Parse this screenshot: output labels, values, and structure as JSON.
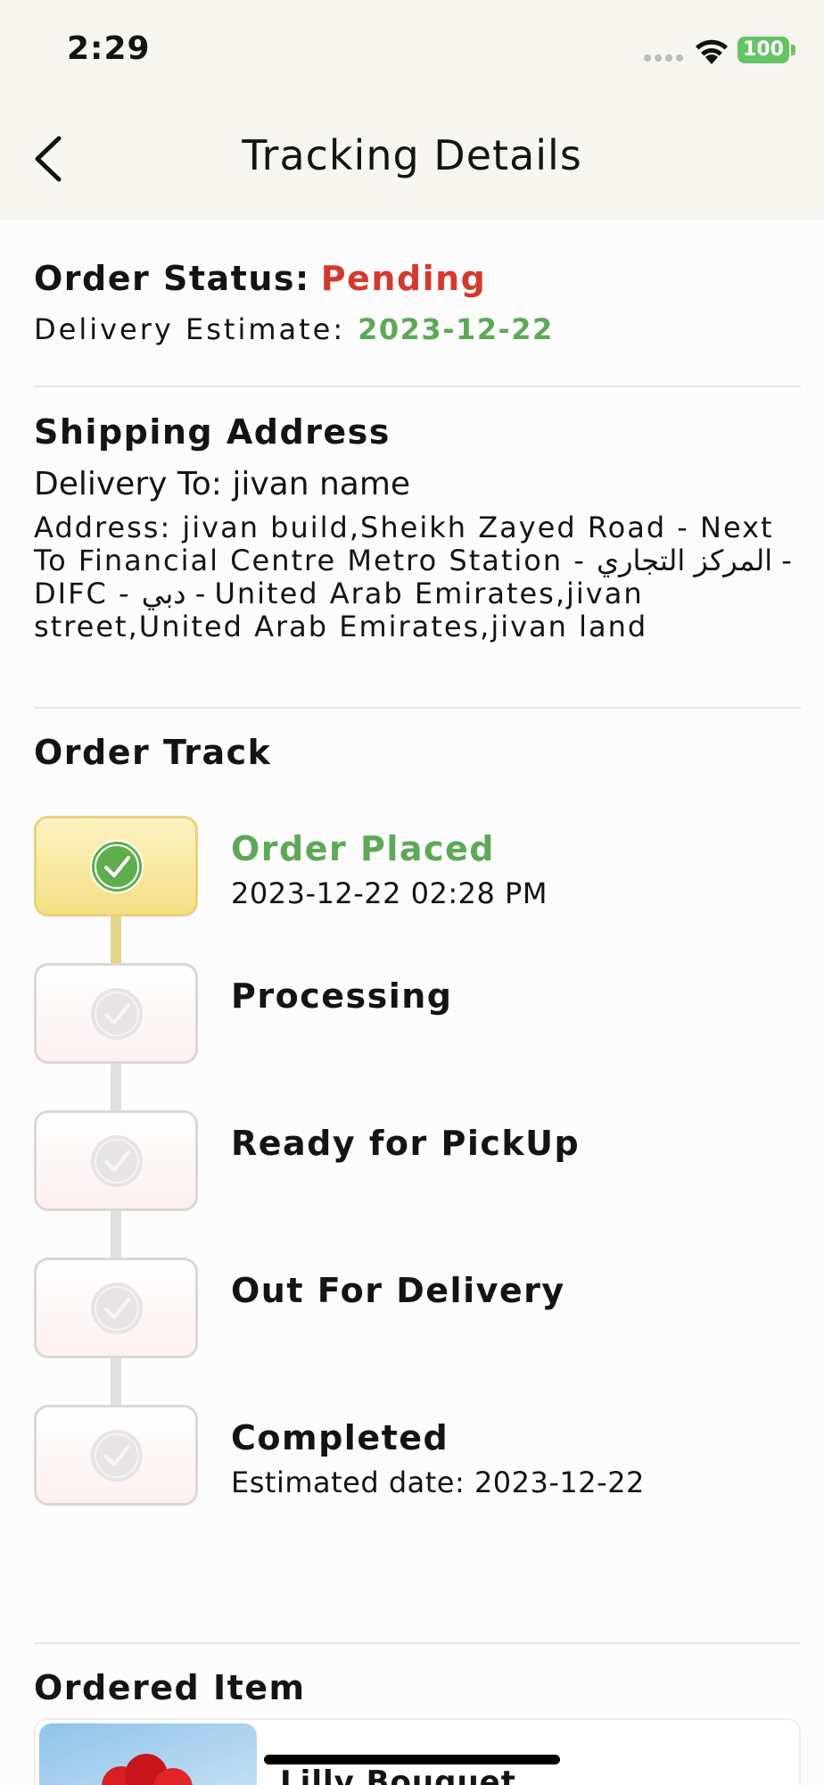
{
  "status_bar": {
    "time": "2:29",
    "battery": "100"
  },
  "header": {
    "title": "Tracking Details"
  },
  "order": {
    "status_label": "Order Status:",
    "status_value": "Pending",
    "estimate_label": "Delivery Estimate:",
    "estimate_value": "2023-12-22"
  },
  "shipping": {
    "title": "Shipping Address",
    "delivery_to": "Delivery To: jivan name",
    "address": "Address: jivan build,Sheikh Zayed Road - Next To Financial Centre Metro Station - المركز التجاري - DIFC - دبي - United Arab Emirates,jivan street,United Arab Emirates,jivan land"
  },
  "track": {
    "title": "Order Track",
    "steps": [
      {
        "label": "Order Placed",
        "sub": "2023-12-22 02:28 PM",
        "done": true
      },
      {
        "label": "Processing",
        "sub": "",
        "done": false
      },
      {
        "label": "Ready for PickUp",
        "sub": "",
        "done": false
      },
      {
        "label": "Out For Delivery",
        "sub": "",
        "done": false
      },
      {
        "label": "Completed",
        "sub": "Estimated date: 2023-12-22",
        "done": false
      }
    ]
  },
  "ordered": {
    "title": "Ordered Item",
    "item_name": "Lilly Bouquet"
  },
  "colors": {
    "pending": "#d33a2f",
    "success": "#5ea858",
    "header_bg": "#f7f5f0"
  },
  "icons": [
    "back-chevron-icon",
    "wifi-icon",
    "battery-icon",
    "check-circle-icon"
  ]
}
